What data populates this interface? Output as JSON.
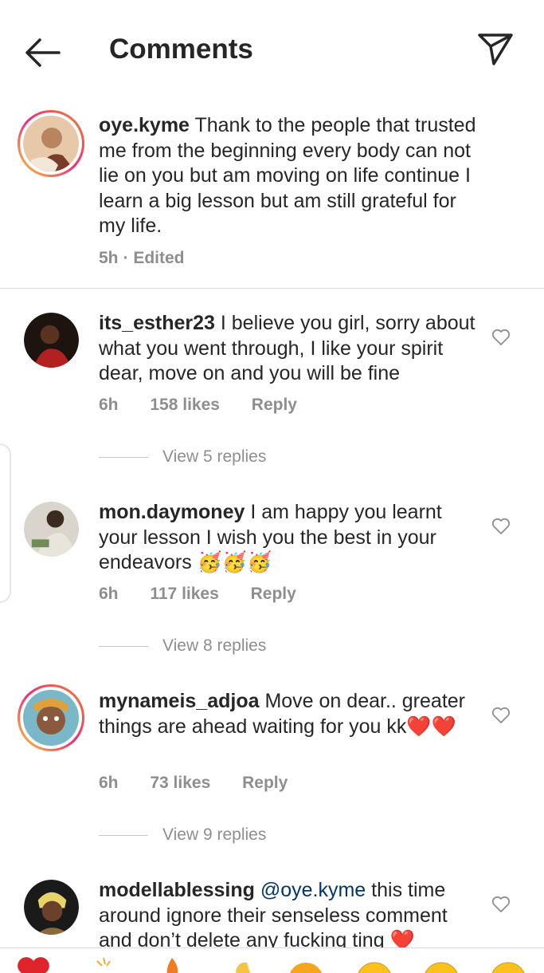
{
  "header": {
    "title": "Comments",
    "back_icon": "arrow-left-icon",
    "send_icon": "paper-plane-icon"
  },
  "caption": {
    "username": "oye.kyme",
    "text": "Thank to the people that trusted me from the beginning every body can not lie on you but am moving on life continue I learn a big lesson but am still grateful for my life.",
    "time": "5h",
    "edited": "· Edited"
  },
  "comments": [
    {
      "username": "its_esther23",
      "text": "I believe you girl, sorry about what you went through, I like your spirit dear, move on and you will be fine",
      "time": "6h",
      "likes": "158 likes",
      "reply": "Reply",
      "view_replies": "View 5 replies"
    },
    {
      "username": "mon.daymoney",
      "text": "I am happy you learnt your lesson I wish you the best in your endeavors",
      "emoji": "🥳🥳🥳",
      "time": "6h",
      "likes": "117 likes",
      "reply": "Reply",
      "view_replies": "View 8 replies"
    },
    {
      "username": "mynameis_adjoa",
      "text": "Move on dear.. greater things are ahead waiting for you kk",
      "emoji": "❤️❤️",
      "time": "6h",
      "likes": "73 likes",
      "reply": "Reply",
      "view_replies": "View 9 replies"
    },
    {
      "username": "modellablessing",
      "mention": "@oye.kyme",
      "text": "this time around ignore their senseless comment and don’t delete any fucking ting",
      "emoji": "❤️"
    }
  ],
  "colors": {
    "accent_heart": "#ed1c24",
    "mention": "#00376b",
    "meta_gray": "#8e8e8e"
  }
}
